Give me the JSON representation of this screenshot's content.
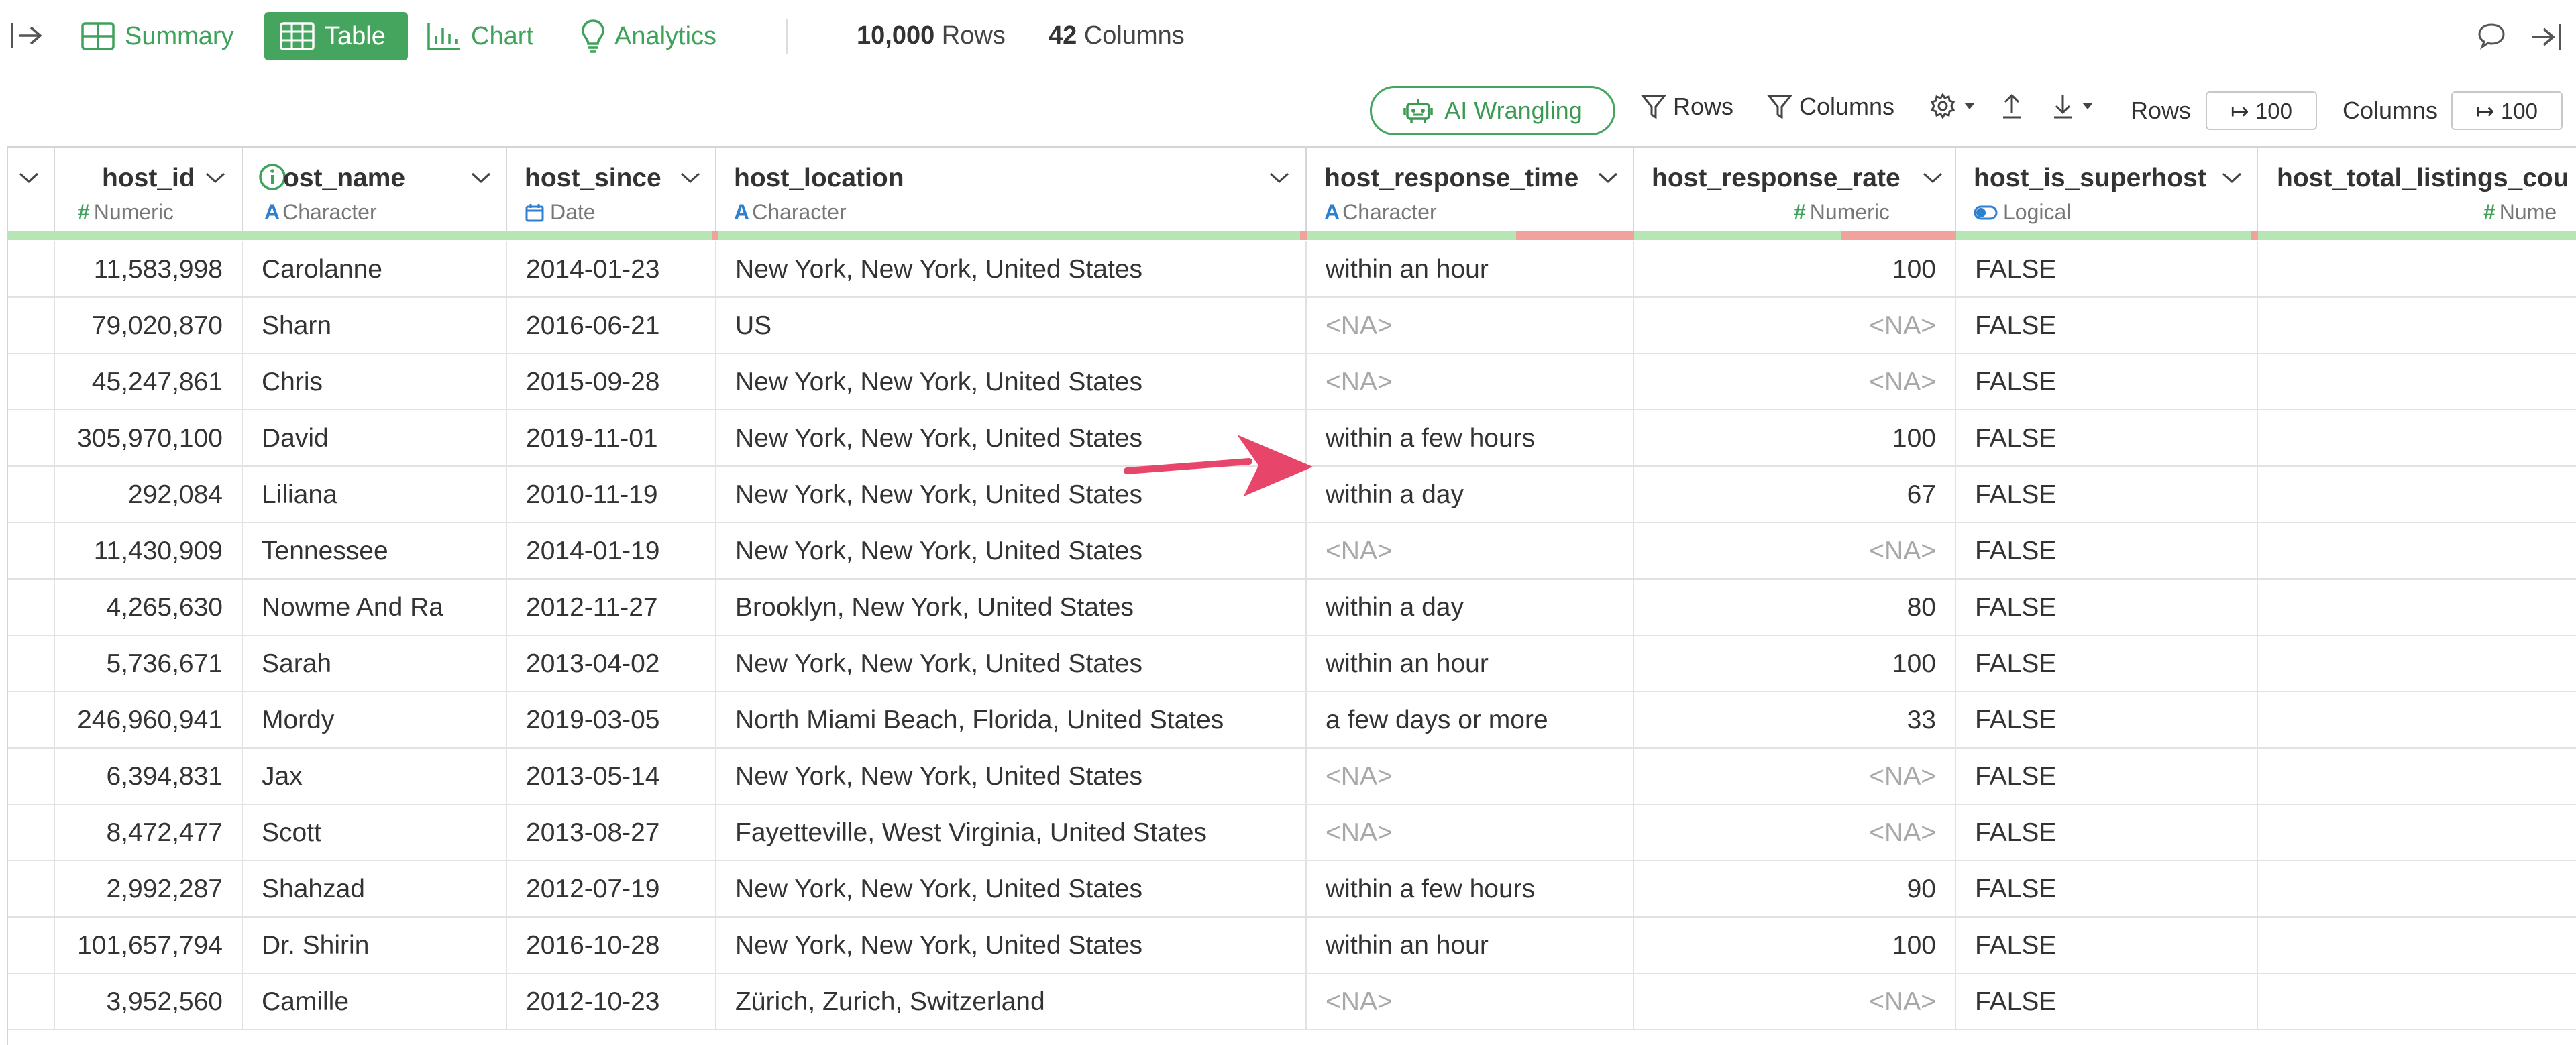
{
  "topbar": {
    "tabs": {
      "summary": "Summary",
      "table": "Table",
      "chart": "Chart",
      "analytics": "Analytics"
    },
    "rows_count": "10,000",
    "rows_word": "Rows",
    "cols_count": "42",
    "cols_word": "Columns"
  },
  "toolbar": {
    "ai_wrangling": "AI Wrangling",
    "rows_filter": "Rows",
    "columns_filter": "Columns",
    "rows_label": "Rows",
    "rows_value": "↦ 100",
    "columns_label": "Columns",
    "columns_value": "↦ 100"
  },
  "columns": [
    {
      "name": "host_id",
      "type": "Numeric"
    },
    {
      "name": "host_name",
      "type": "Character"
    },
    {
      "name": "host_since",
      "type": "Date"
    },
    {
      "name": "host_location",
      "type": "Character"
    },
    {
      "name": "host_response_time",
      "type": "Character"
    },
    {
      "name": "host_response_rate",
      "type": "Numeric"
    },
    {
      "name": "host_is_superhost",
      "type": "Logical"
    },
    {
      "name": "host_total_listings_cou",
      "type": "Nume"
    }
  ],
  "name_partial": "ost_name",
  "rows": [
    [
      "11,583,998",
      "Carolanne",
      "2014-01-23",
      "New York, New York, United States",
      "within an hour",
      "100",
      "FALSE"
    ],
    [
      "79,020,870",
      "Sharn",
      "2016-06-21",
      "US",
      "<NA>",
      "<NA>",
      "FALSE"
    ],
    [
      "45,247,861",
      "Chris",
      "2015-09-28",
      "New York, New York, United States",
      "<NA>",
      "<NA>",
      "FALSE"
    ],
    [
      "305,970,100",
      "David",
      "2019-11-01",
      "New York, New York, United States",
      "within a few hours",
      "100",
      "FALSE"
    ],
    [
      "292,084",
      "Liliana",
      "2010-11-19",
      "New York, New York, United States",
      "within a day",
      "67",
      "FALSE"
    ],
    [
      "11,430,909",
      "Tennessee",
      "2014-01-19",
      "New York, New York, United States",
      "<NA>",
      "<NA>",
      "FALSE"
    ],
    [
      "4,265,630",
      "Nowme And Ra",
      "2012-11-27",
      "Brooklyn, New York, United States",
      "within a day",
      "80",
      "FALSE"
    ],
    [
      "5,736,671",
      "Sarah",
      "2013-04-02",
      "New York, New York, United States",
      "within an hour",
      "100",
      "FALSE"
    ],
    [
      "246,960,941",
      "Mordy",
      "2019-03-05",
      "North Miami Beach, Florida, United States",
      "a few days or more",
      "33",
      "FALSE"
    ],
    [
      "6,394,831",
      "Jax",
      "2013-05-14",
      "New York, New York, United States",
      "<NA>",
      "<NA>",
      "FALSE"
    ],
    [
      "8,472,477",
      "Scott",
      "2013-08-27",
      "Fayetteville, West Virginia, United States",
      "<NA>",
      "<NA>",
      "FALSE"
    ],
    [
      "2,992,287",
      "Shahzad",
      "2012-07-19",
      "New York, New York, United States",
      "within a few hours",
      "90",
      "FALSE"
    ],
    [
      "101,657,794",
      "Dr. Shirin",
      "2016-10-28",
      "New York, New York, United States",
      "within an hour",
      "100",
      "FALSE"
    ],
    [
      "3,952,560",
      "Camille",
      "2012-10-23",
      "Zürich, Zurich, Switzerland",
      "<NA>",
      "<NA>",
      "FALSE"
    ]
  ],
  "colors": {
    "accent": "#45a55f",
    "quality_ok": "#b6e6b3",
    "quality_missing": "#f0a29c",
    "arrow": "#e8456a"
  }
}
